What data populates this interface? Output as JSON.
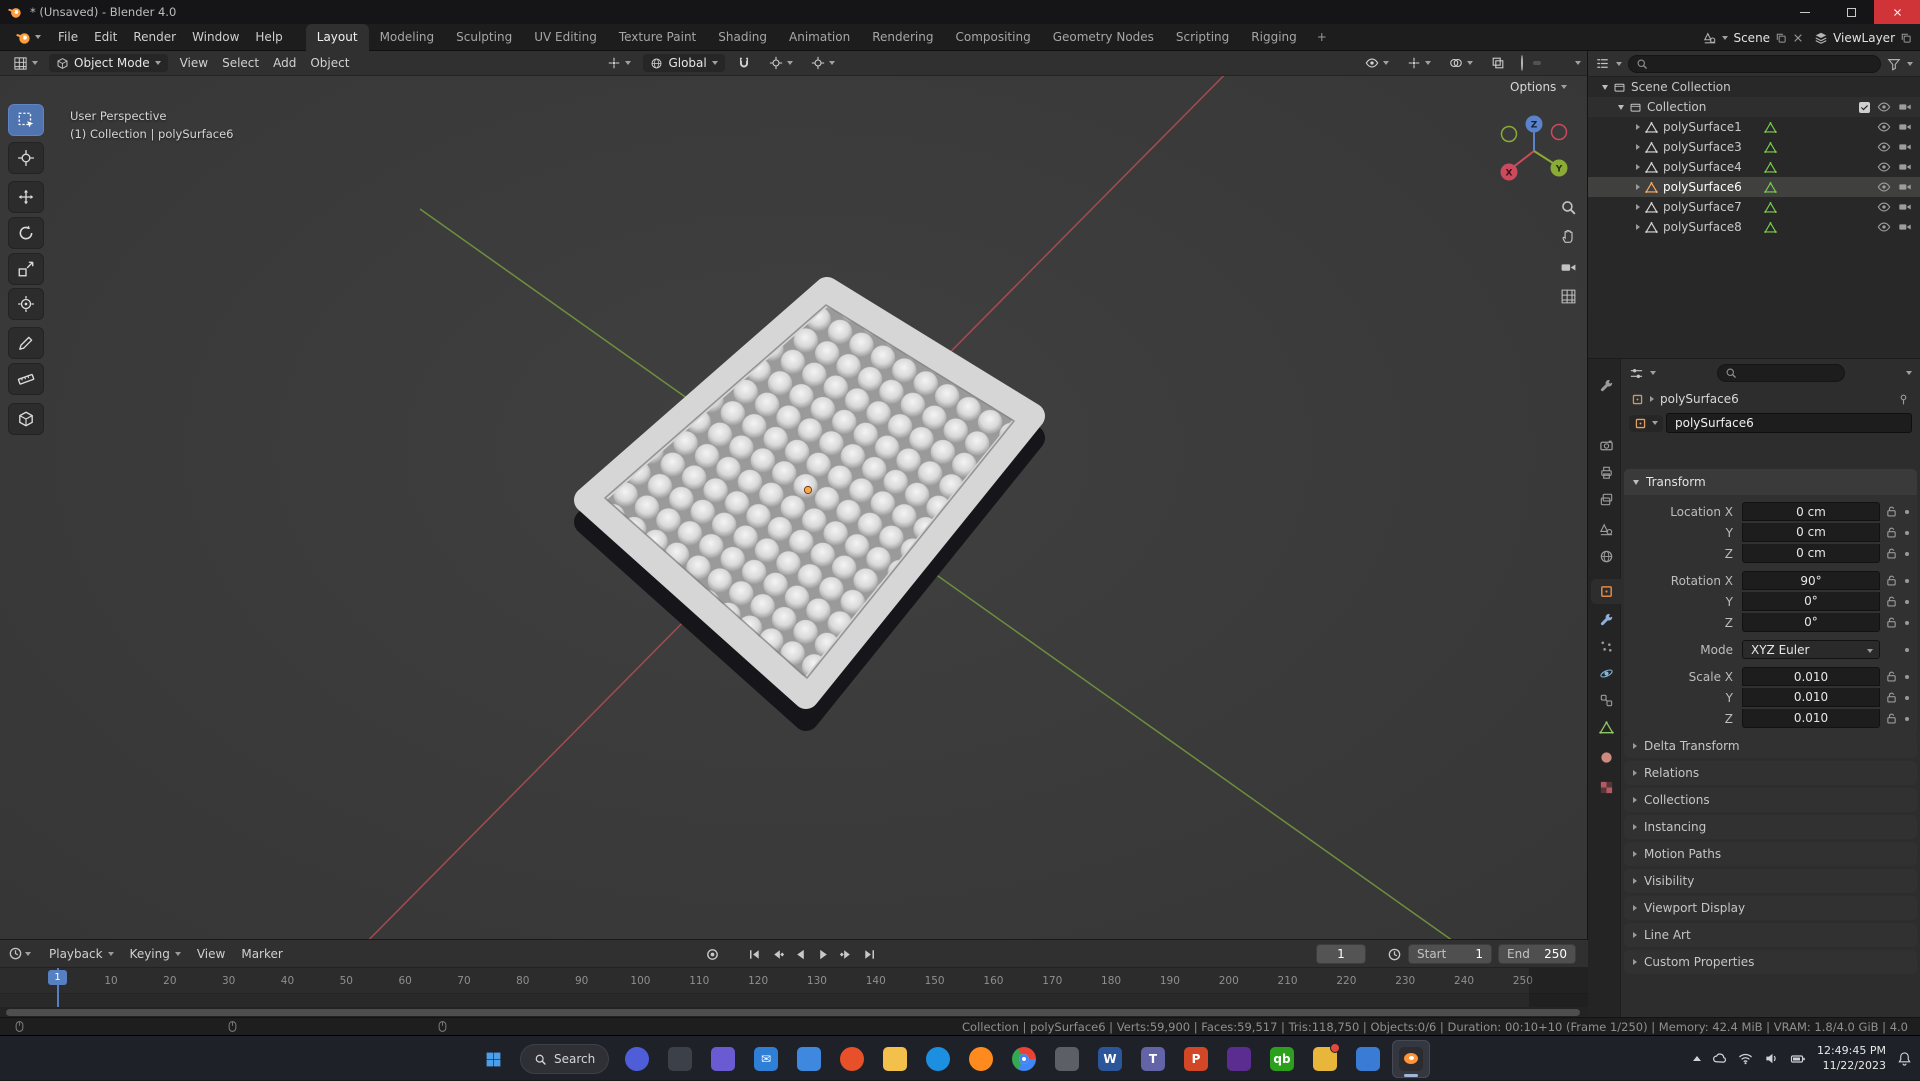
{
  "window": {
    "title": "* (Unsaved) - Blender 4.0"
  },
  "menubar": {
    "menus": [
      "File",
      "Edit",
      "Render",
      "Window",
      "Help"
    ],
    "workspaces": [
      {
        "label": "Layout",
        "active": true
      },
      {
        "label": "Modeling"
      },
      {
        "label": "Sculpting"
      },
      {
        "label": "UV Editing"
      },
      {
        "label": "Texture Paint"
      },
      {
        "label": "Shading"
      },
      {
        "label": "Animation"
      },
      {
        "label": "Rendering"
      },
      {
        "label": "Compositing"
      },
      {
        "label": "Geometry Nodes"
      },
      {
        "label": "Scripting"
      },
      {
        "label": "Rigging"
      }
    ],
    "add_workspace_label": "+",
    "scene_selector": "Scene",
    "view_layer_selector": "ViewLayer"
  },
  "viewport": {
    "header": {
      "mode": "Object Mode",
      "menus": [
        "View",
        "Select",
        "Add",
        "Object"
      ],
      "orientation": "Global"
    },
    "options_label": "Options",
    "overlay": {
      "line1": "User Perspective",
      "line2": "(1) Collection | polySurface6"
    },
    "gizmo": {
      "x": "X",
      "y": "Y",
      "z": "Z"
    },
    "tools": [
      "select-box",
      "cursor-3d",
      "move",
      "rotate",
      "scale",
      "transform",
      "annotate",
      "measure",
      "add-cube"
    ],
    "side_icons": [
      "zoom",
      "pan-hand",
      "camera-view",
      "toggle-orthographic"
    ]
  },
  "outliner": {
    "scene_collection": "Scene Collection",
    "collection": "Collection",
    "objects": [
      {
        "label": "polySurface1"
      },
      {
        "label": "polySurface3"
      },
      {
        "label": "polySurface4"
      },
      {
        "label": "polySurface6",
        "active": true
      },
      {
        "label": "polySurface7"
      },
      {
        "label": "polySurface8"
      }
    ]
  },
  "properties": {
    "breadcrumb": "polySurface6",
    "object_name": "polySurface6",
    "tabs": [
      "tool",
      "render",
      "output",
      "view-layer",
      "scene",
      "world",
      "object",
      "modifiers",
      "particles",
      "physics",
      "constraints",
      "object-data",
      "material",
      "texture"
    ],
    "active_tab": "object",
    "transform": {
      "title": "Transform",
      "rows": [
        {
          "label": "Location X",
          "value": "0 cm",
          "cls": "grp-start"
        },
        {
          "label": "Y",
          "value": "0 cm",
          "cls": "grp-mid"
        },
        {
          "label": "Z",
          "value": "0 cm",
          "cls": "grp-end"
        },
        {
          "label": "Rotation X",
          "value": "90°",
          "cls": "grp-start gap"
        },
        {
          "label": "Y",
          "value": "0°",
          "cls": "grp-mid"
        },
        {
          "label": "Z",
          "value": "0°",
          "cls": "grp-end"
        },
        {
          "label": "Mode",
          "value": "XYZ Euler",
          "cls": "dropdown gap"
        },
        {
          "label": "Scale X",
          "value": "0.010",
          "cls": "grp-start gap"
        },
        {
          "label": "Y",
          "value": "0.010",
          "cls": "grp-mid"
        },
        {
          "label": "Z",
          "value": "0.010",
          "cls": "grp-end"
        }
      ]
    },
    "sections": [
      "Delta Transform",
      "Relations",
      "Collections",
      "Instancing",
      "Motion Paths",
      "Visibility",
      "Viewport Display",
      "Line Art",
      "Custom Properties"
    ]
  },
  "timeline": {
    "menus": [
      {
        "label": "Playback",
        "cls": "chevm"
      },
      {
        "label": "Keying",
        "cls": "chevm"
      },
      {
        "label": "View"
      },
      {
        "label": "Marker"
      }
    ],
    "current_frame": "1",
    "start": {
      "label": "Start",
      "value": "1"
    },
    "end": {
      "label": "End",
      "value": "250"
    },
    "ticks": [
      "10",
      "20",
      "30",
      "40",
      "50",
      "60",
      "70",
      "80",
      "90",
      "100",
      "110",
      "120",
      "130",
      "140",
      "150",
      "160",
      "170",
      "180",
      "190",
      "200",
      "210",
      "220",
      "230",
      "240",
      "250"
    ]
  },
  "statusbar": {
    "text": "Collection | polySurface6 | Verts:59,900 | Faces:59,517 | Tris:118,750 | Objects:0/6 | Duration: 00:10+10 (Frame 1/250) | Memory: 42.4 MiB | VRAM: 1.8/4.0 GiB | 4.0"
  },
  "taskbar": {
    "search_label": "Search",
    "apps": [
      {
        "name": "copilot",
        "color": "#4e5dd8",
        "cls": "circle"
      },
      {
        "name": "system-window",
        "color": "#3c4048"
      },
      {
        "name": "app-purple",
        "color": "#6b5bd2"
      },
      {
        "name": "mail",
        "color": "#2f7fd6",
        "glyph": "✉"
      },
      {
        "name": "calendar",
        "color": "#3f88e0"
      },
      {
        "name": "brave",
        "color": "#e8502a",
        "cls": "circle"
      },
      {
        "name": "file-explorer",
        "color": "#f3c14b"
      },
      {
        "name": "edge",
        "color": "#1d8fe0",
        "cls": "circle"
      },
      {
        "name": "firefox",
        "color": "#ff8a1e",
        "cls": "circle"
      },
      {
        "name": "chrome",
        "cls": "circle chrome"
      },
      {
        "name": "camera",
        "color": "#5c6066"
      },
      {
        "name": "word",
        "color": "#2b579a",
        "glyph": "W"
      },
      {
        "name": "teams",
        "color": "#6264a7",
        "glyph": "T"
      },
      {
        "name": "powerpoint",
        "color": "#d24726",
        "glyph": "P"
      },
      {
        "name": "visual-studio",
        "color": "#5c2d91"
      },
      {
        "name": "quickbooks",
        "color": "#2ca01c",
        "glyph": "qb"
      },
      {
        "name": "notifier-app",
        "color": "#e8b63a",
        "cls": "badged"
      },
      {
        "name": "remote-desktop",
        "color": "#3a7bd5"
      },
      {
        "name": "blender",
        "cls": "active blender"
      }
    ],
    "tray_icons": [
      "hidden-icons-chevron",
      "cloud",
      "wifi",
      "volume",
      "battery"
    ],
    "clock": {
      "time": "12:49:45 PM",
      "date": "11/22/2023"
    }
  }
}
